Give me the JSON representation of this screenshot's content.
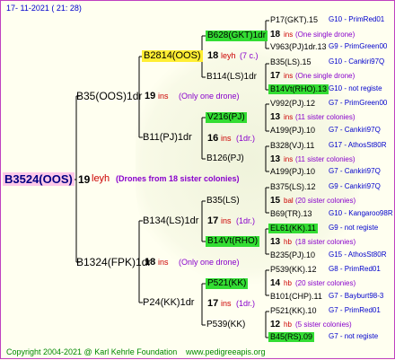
{
  "date": "17- 11-2021 ( 21: 28)",
  "footer": {
    "copyright": "Copyright 2004-2021 @ Karl Kehrle Foundation",
    "url": "www.pedigreeapis.org"
  },
  "colors": {
    "green": "#33dd33",
    "yellow": "#ffee33",
    "pink": "#ffc8e8",
    "blue": "#0000cc",
    "red": "#cc0000",
    "purple": "#8800cc"
  },
  "root": {
    "name": "B3524(OOS)",
    "gen": "19",
    "code": "leyh",
    "note": "(Drones from 18 sister colonies)"
  },
  "gen1": [
    {
      "name": "B35(OOS)1dr",
      "gen": "19",
      "code": "ins",
      "note": "(Only one drone)"
    },
    {
      "name": "B1324(FPK)1dr",
      "gen": "18",
      "code": "ins",
      "note": "(Only one drone)"
    }
  ],
  "gen2": [
    {
      "name": "B2814(OOS)",
      "gen": "18",
      "code": "leyh",
      "note": "(7 c.)"
    },
    {
      "name": "B11(PJ)1dr",
      "gen": "16",
      "code": "ins",
      "note": "(1dr.)"
    },
    {
      "name": "B134(LS)1dr",
      "gen": "17",
      "code": "ins",
      "note": "(1dr.)"
    },
    {
      "name": "P24(KK)1dr",
      "gen": "17",
      "code": "ins",
      "note": "(1dr.)"
    }
  ],
  "gen3": [
    {
      "name": "B628(GKT)1dr",
      "gen": "18",
      "code": "ins",
      "note": "(One single drone)"
    },
    {
      "name": "B114(LS)1dr"
    },
    {
      "name": "V216(PJ)",
      "gen": "13",
      "code": "ins",
      "note": "(1dr.)"
    },
    {
      "name": "B126(PJ)"
    },
    {
      "name": "B35(LS)"
    },
    {
      "name": "B14Vt(RHO)"
    },
    {
      "name": "P521(KK)",
      "gen": "14",
      "code": "hb",
      "note": "(1dr.)"
    },
    {
      "name": "P539(KK)"
    }
  ],
  "gen4": [
    {
      "name": "P17(GKT).15",
      "suffix": "G10 - PrimRed01"
    },
    {
      "count": "18",
      "code": "ins",
      "note": "(One single drone)"
    },
    {
      "name": "V963(PJ)1dr.13",
      "suffix": "G9 - PrimGreen00"
    },
    {
      "name": "B35(LS).15",
      "suffix": "G10 - Cankiri97Q"
    },
    {
      "count": "17",
      "code": "ins",
      "note": "(One single drone)"
    },
    {
      "name": "B14Vt(RHO).13",
      "suffix": "G10 - not registe"
    },
    {
      "name": "V992(PJ).12",
      "suffix": "G7 - PrimGreen00"
    },
    {
      "count": "13",
      "code": "ins",
      "note": "(11 sister colonies)"
    },
    {
      "name": "A199(PJ).10",
      "suffix": "G7 - Cankiri97Q"
    },
    {
      "name": "B328(VJ).11",
      "suffix": "G17 - AthosSt80R"
    },
    {
      "count": "13",
      "code": "ins",
      "note": "(11 sister colonies)"
    },
    {
      "name": "A199(PJ).10",
      "suffix": "G7 - Cankiri97Q"
    },
    {
      "name": "B375(LS).12",
      "suffix": "G9 - Cankiri97Q"
    },
    {
      "count": "15",
      "code": "bal",
      "note": "(20 sister colonies)"
    },
    {
      "name": "B69(TR).13",
      "suffix": "G10 - Kangaroo98R"
    },
    {
      "name": "EL61(KK).11",
      "suffix": "G9 - not registe"
    },
    {
      "count": "13",
      "code": "hb",
      "note": "(18 sister colonies)"
    },
    {
      "name": "B235(PJ).10",
      "suffix": "G15 - AthosSt80R"
    },
    {
      "name": "P539(KK).12",
      "suffix": "G8 - PrimRed01"
    },
    {
      "count": "14",
      "code": "hb",
      "note": "(20 sister colonies)"
    },
    {
      "name": "B101(CHP).11",
      "suffix": "G7 - Bayburt98-3"
    },
    {
      "name": "P521(KK).10",
      "suffix": "G7 - PrimRed01"
    },
    {
      "count": "12",
      "code": "hb",
      "note": "(5 sister colonies)"
    },
    {
      "name": "B45(RS).09",
      "suffix": "G7 - not registe"
    }
  ]
}
